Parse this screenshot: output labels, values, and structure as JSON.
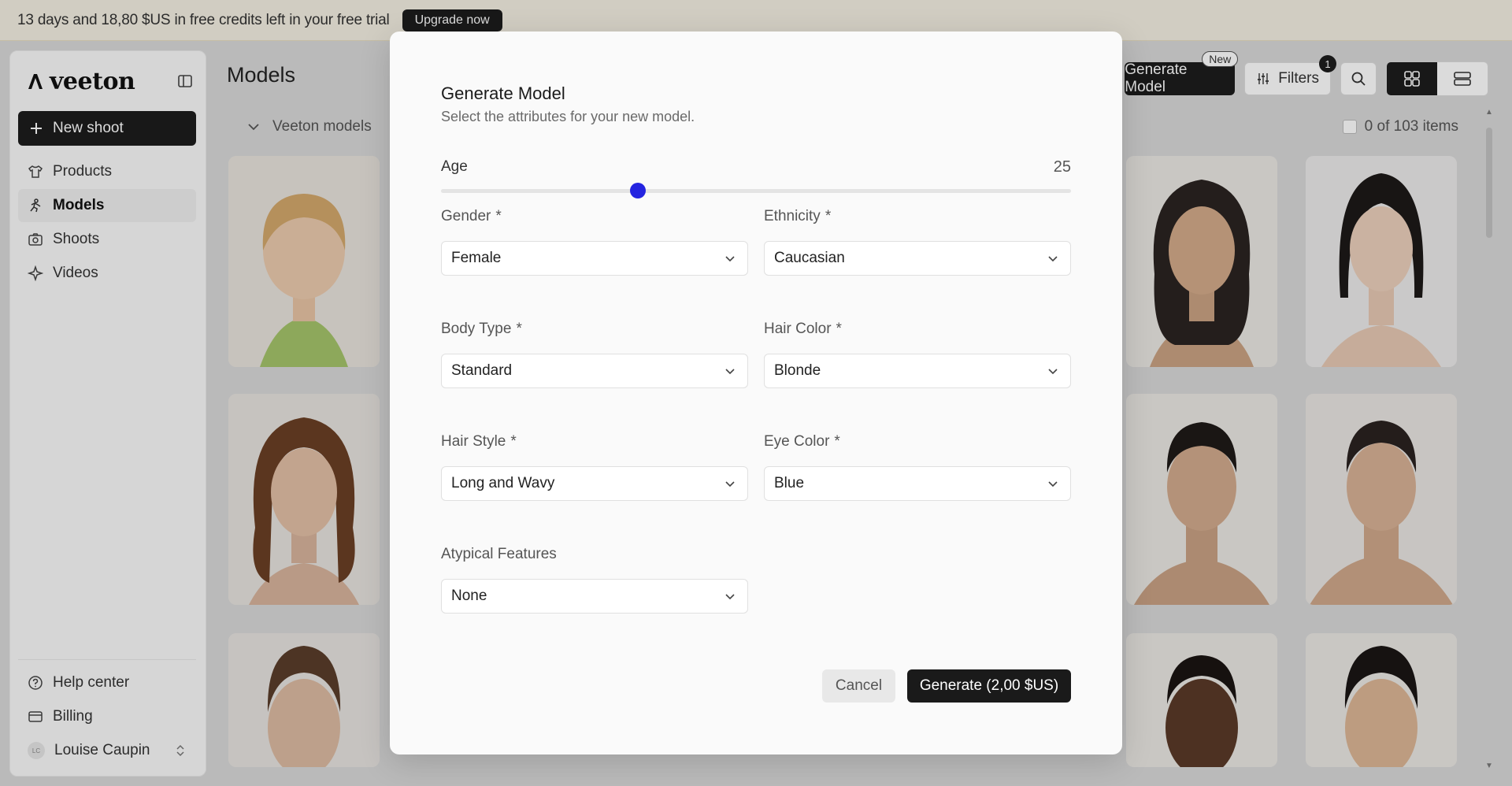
{
  "banner": {
    "text": "13 days and 18,80 $US in free credits left in your free trial",
    "upgrade_label": "Upgrade now"
  },
  "sidebar": {
    "brand": "veeton",
    "new_shoot_label": "New shoot",
    "items": [
      {
        "label": "Products",
        "icon": "shirt-icon"
      },
      {
        "label": "Models",
        "icon": "person-icon",
        "active": true
      },
      {
        "label": "Shoots",
        "icon": "camera-icon"
      },
      {
        "label": "Videos",
        "icon": "sparkle-icon"
      }
    ],
    "bottom": [
      {
        "label": "Help center",
        "icon": "help-icon"
      },
      {
        "label": "Billing",
        "icon": "credit-card-icon"
      }
    ],
    "user": {
      "name": "Louise Caupin",
      "initials": "LC"
    }
  },
  "main": {
    "title": "Models",
    "collection_label": "Veeton models",
    "generate_label": "Generate Model",
    "new_badge": "New",
    "filters_label": "Filters",
    "filters_count": "1",
    "items_count": "0 of 103 items"
  },
  "modal": {
    "title": "Generate Model",
    "subtitle": "Select the attributes for your new model.",
    "age": {
      "label": "Age",
      "value": 25,
      "min": 0,
      "max": 80
    },
    "fields": {
      "gender": {
        "label": "Gender",
        "value": "Female"
      },
      "ethnicity": {
        "label": "Ethnicity",
        "value": "Caucasian"
      },
      "body_type": {
        "label": "Body Type",
        "value": "Standard"
      },
      "hair_color": {
        "label": "Hair Color",
        "value": "Blonde"
      },
      "hair_style": {
        "label": "Hair Style",
        "value": "Long and Wavy"
      },
      "eye_color": {
        "label": "Eye Color",
        "value": "Blue"
      },
      "atypical": {
        "label": "Atypical Features",
        "value": "None"
      }
    },
    "required_mark": "*",
    "cancel_label": "Cancel",
    "generate_label": "Generate (2,00 $US)"
  },
  "colors": {
    "accent": "#2424e0",
    "dark": "#1a1a1a",
    "banner_bg": "#f4efe2"
  }
}
